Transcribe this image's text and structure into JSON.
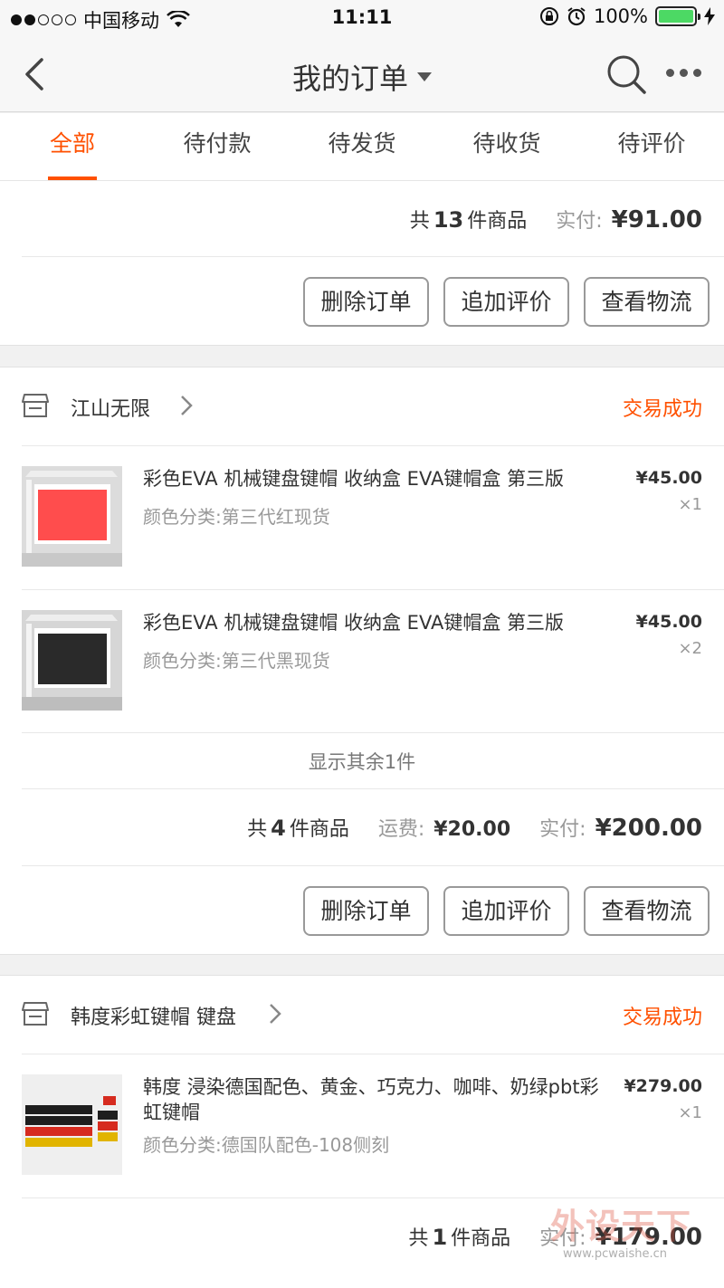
{
  "status_bar": {
    "carrier": "中国移动",
    "time": "11:11",
    "battery": "100%"
  },
  "nav": {
    "title": "我的订单"
  },
  "tabs": [
    {
      "label": "全部"
    },
    {
      "label": "待付款"
    },
    {
      "label": "待发货"
    },
    {
      "label": "待收货"
    },
    {
      "label": "待评价"
    }
  ],
  "order1": {
    "count_prefix": "共",
    "count": "13",
    "count_suffix": "件商品",
    "paid_label": "实付:",
    "paid": "¥91.00",
    "buttons": {
      "delete": "删除订单",
      "review": "追加评价",
      "logistics": "查看物流"
    }
  },
  "order2": {
    "shop": "江山无限",
    "status": "交易成功",
    "items": [
      {
        "title": "彩色EVA 机械键盘键帽 收纳盒 EVA键帽盒 第三版",
        "sku": "颜色分类:第三代红现货",
        "price": "¥45.00",
        "qty": "×1"
      },
      {
        "title": "彩色EVA 机械键盘键帽 收纳盒 EVA键帽盒 第三版",
        "sku": "颜色分类:第三代黑现货",
        "price": "¥45.00",
        "qty": "×2"
      }
    ],
    "more": "显示其余1件",
    "count_prefix": "共",
    "count": "4",
    "count_suffix": "件商品",
    "shipping_label": "运费:",
    "shipping": "¥20.00",
    "paid_label": "实付:",
    "paid": "¥200.00",
    "buttons": {
      "delete": "删除订单",
      "review": "追加评价",
      "logistics": "查看物流"
    }
  },
  "order3": {
    "shop": "韩度彩虹键帽 键盘",
    "status": "交易成功",
    "items": [
      {
        "title": "韩度 浸染德国配色、黄金、巧克力、咖啡、奶绿pbt彩虹键帽",
        "sku": "颜色分类:德国队配色-108侧刻",
        "price": "¥279.00",
        "qty": "×1"
      }
    ],
    "count_prefix": "共",
    "count": "1",
    "count_suffix": "件商品",
    "paid_label": "实付:",
    "paid": "¥179.00"
  },
  "watermark": {
    "text": "外设天下",
    "url": "www.pcwaishe.cn"
  },
  "colors": {
    "accent": "#ff5000",
    "muted": "#999999",
    "battery": "#4cd964"
  }
}
